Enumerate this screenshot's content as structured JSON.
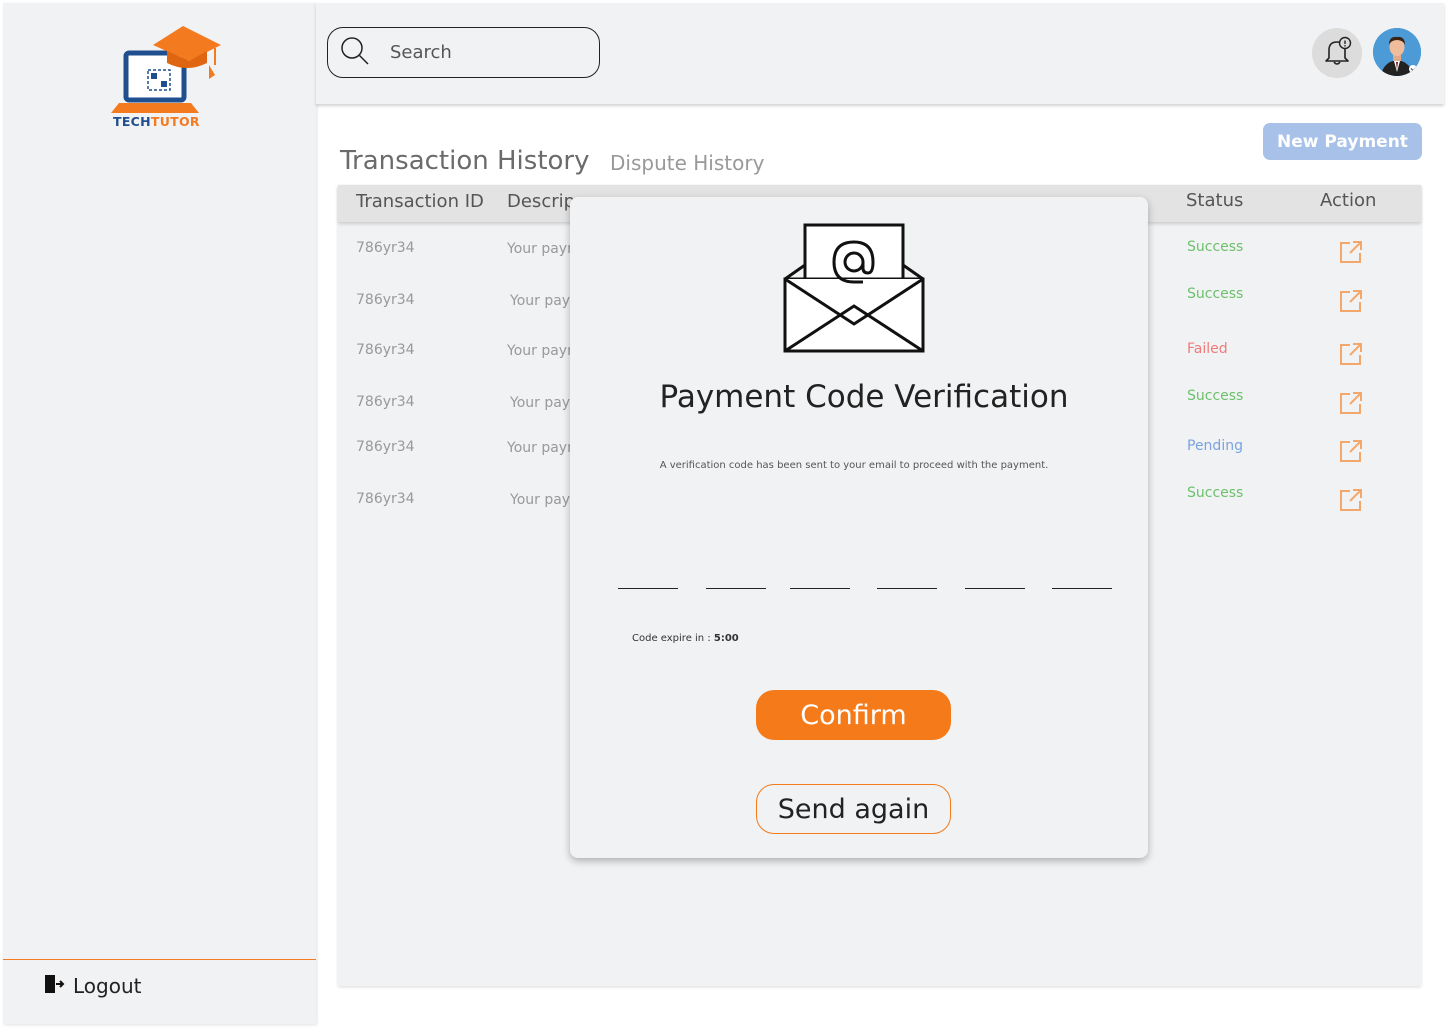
{
  "brand": {
    "name_part1": "TECH",
    "name_part2": "TUTOR"
  },
  "sidebar": {
    "logout_label": "Logout"
  },
  "header": {
    "search_placeholder": "Search"
  },
  "tabs": {
    "active": "Transaction History",
    "inactive": "Dispute History"
  },
  "new_payment_label": "New Payment",
  "table": {
    "columns": [
      "Transaction ID",
      "Descrip",
      "Status",
      "Action"
    ],
    "rows": [
      {
        "id": "786yr34",
        "desc": "Your payr",
        "status": "Success"
      },
      {
        "id": "786yr34",
        "desc": "Your payr",
        "status": "Success"
      },
      {
        "id": "786yr34",
        "desc": "Your payr",
        "status": "Failed"
      },
      {
        "id": "786yr34",
        "desc": "Your payr",
        "status": "Success"
      },
      {
        "id": "786yr34",
        "desc": "Your payr",
        "status": "Pending"
      },
      {
        "id": "786yr34",
        "desc": "Your payr",
        "status": "Success"
      }
    ]
  },
  "colors": {
    "accent": "#f47a1a",
    "success": "#6cc06c",
    "failed": "#f07a7a",
    "pending": "#7aa3e0",
    "brand_blue": "#1f4f8f"
  },
  "modal": {
    "title": "Payment Code Verification",
    "subtitle": "A verification code has been sent to your email to proceed with the payment.",
    "expire_label": "Code expire in : ",
    "expire_value": "5:00",
    "code_digits": [
      "",
      "",
      "",
      "",
      "",
      ""
    ],
    "confirm_label": "Confirm",
    "send_again_label": "Send again"
  }
}
